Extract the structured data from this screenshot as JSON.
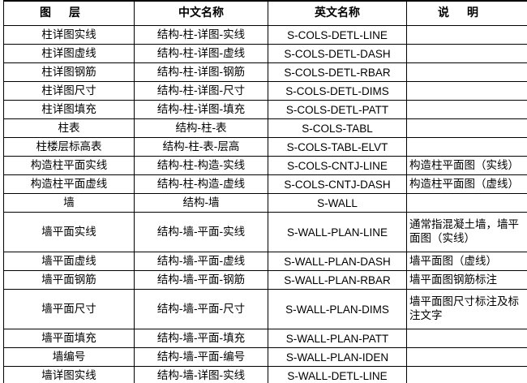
{
  "table": {
    "headers": [
      "图层",
      "中文名称",
      "英文名称",
      "说明"
    ],
    "rows": [
      {
        "layer": "柱详图实线",
        "cn": "结构-柱-详图-实线",
        "en": "S-COLS-DETL-LINE",
        "note": ""
      },
      {
        "layer": "柱详图虚线",
        "cn": "结构-柱-详图-虚线",
        "en": "S-COLS-DETL-DASH",
        "note": ""
      },
      {
        "layer": "柱详图钢筋",
        "cn": "结构-柱-详图-钢筋",
        "en": "S-COLS-DETL-RBAR",
        "note": ""
      },
      {
        "layer": "柱详图尺寸",
        "cn": "结构-柱-详图-尺寸",
        "en": "S-COLS-DETL-DIMS",
        "note": ""
      },
      {
        "layer": "柱详图填充",
        "cn": "结构-柱-详图-填充",
        "en": "S-COLS-DETL-PATT",
        "note": ""
      },
      {
        "layer": "柱表",
        "cn": "结构-柱-表",
        "en": "S-COLS-TABL",
        "note": ""
      },
      {
        "layer": "柱楼层标高表",
        "cn": "结构-柱-表-层高",
        "en": "S-COLS-TABL-ELVT",
        "note": ""
      },
      {
        "layer": "构造柱平面实线",
        "cn": "结构-柱-构造-实线",
        "en": "S-COLS-CNTJ-LINE",
        "note": "构造柱平面图（实线）"
      },
      {
        "layer": "构造柱平面虚线",
        "cn": "结构-柱-构造-虚线",
        "en": "S-COLS-CNTJ-DASH",
        "note": "构造柱平面图（虚线）"
      },
      {
        "layer": "墙",
        "cn": "结构-墙",
        "en": "S-WALL",
        "note": ""
      },
      {
        "layer": "墙平面实线",
        "cn": "结构-墙-平面-实线",
        "en": "S-WALL-PLAN-LINE",
        "note": "通常指混凝土墙，墙平面图（实线）"
      },
      {
        "layer": "墙平面虚线",
        "cn": "结构-墙-平面-虚线",
        "en": "S-WALL-PLAN-DASH",
        "note": "墙平面图（虚线）"
      },
      {
        "layer": "墙平面钢筋",
        "cn": "结构-墙-平面-钢筋",
        "en": "S-WALL-PLAN-RBAR",
        "note": "墙平面图钢筋标注"
      },
      {
        "layer": "墙平面尺寸",
        "cn": "结构-墙-平面-尺寸",
        "en": "S-WALL-PLAN-DIMS",
        "note": "墙平面图尺寸标注及标注文字"
      },
      {
        "layer": "墙平面填充",
        "cn": "结构-墙-平面-填充",
        "en": "S-WALL-PLAN-PATT",
        "note": ""
      },
      {
        "layer": "墙编号",
        "cn": "结构-墙-平面-编号",
        "en": "S-WALL-PLAN-IDEN",
        "note": ""
      },
      {
        "layer": "墙详图实线",
        "cn": "结构-墙-详图-实线",
        "en": "S-WALL-DETL-LINE",
        "note": ""
      }
    ]
  }
}
